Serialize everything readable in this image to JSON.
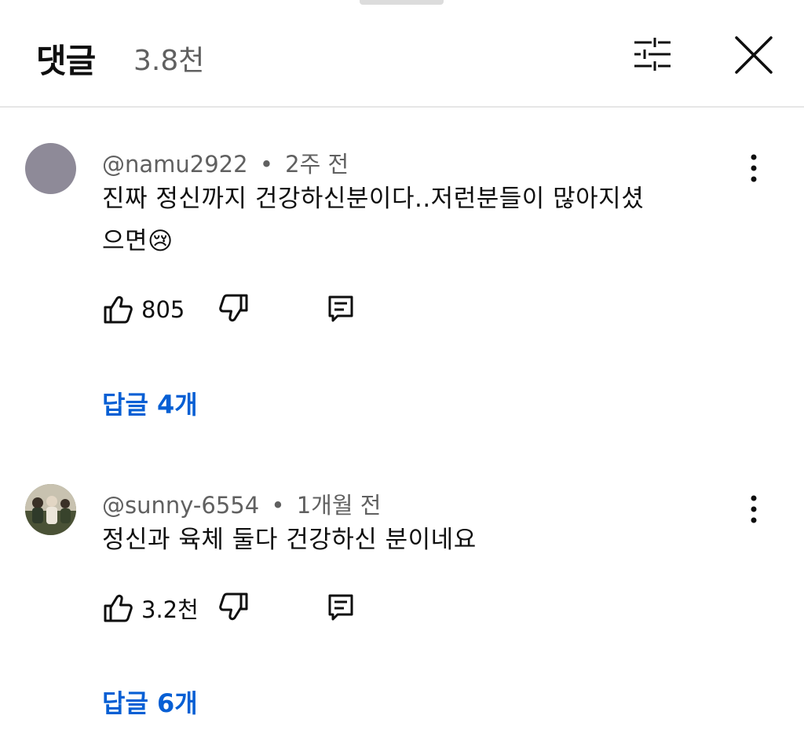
{
  "header": {
    "title": "댓글",
    "count": "3.8천",
    "filter_icon": "tune-icon",
    "close_icon": "close-icon"
  },
  "comments": [
    {
      "author": "@namu2922",
      "separator": "•",
      "time": "2주 전",
      "text": "진짜 정신까지 건강하신분이다..저런분들이 많아지셨으면😢",
      "likes": "805",
      "replies": "답글 4개",
      "avatar_color": "#8e8a98"
    },
    {
      "author": "@sunny-6554",
      "separator": "•",
      "time": "1개월 전",
      "text": "정신과 육체 둘다 건강하신 분이네요",
      "likes": "3.2천",
      "replies": "답글 6개",
      "avatar_color": "#6f7a5a"
    }
  ],
  "colors": {
    "link": "#065fd4",
    "secondary_text": "#606060",
    "divider": "#e6e6e6"
  }
}
